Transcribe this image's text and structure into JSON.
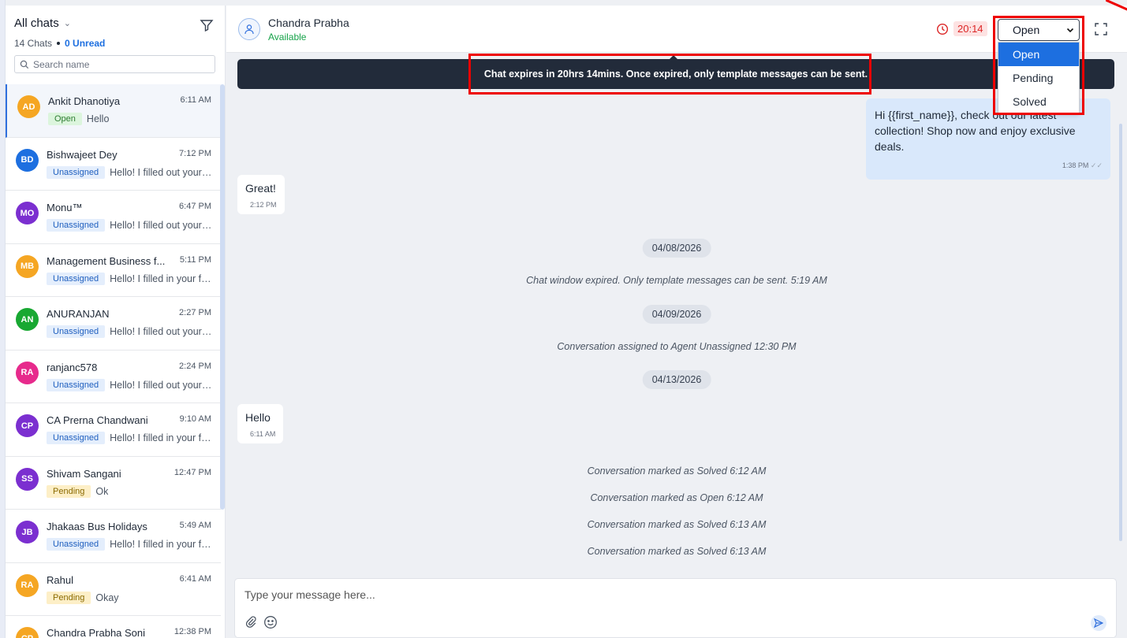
{
  "sidebar": {
    "title": "All chats",
    "chats_count": "14 Chats",
    "unread": "0 Unread",
    "search_placeholder": "Search name",
    "chats": [
      {
        "initials": "AD",
        "name": "Ankit Dhanotiya",
        "time": "6:11 AM",
        "status": "Open",
        "message": "Hello",
        "color": "#f5a623"
      },
      {
        "initials": "BD",
        "name": "Bishwajeet Dey",
        "time": "7:12 PM",
        "status": "Unassigned",
        "message": "Hello! I filled out your form...",
        "color": "#1d6fe0"
      },
      {
        "initials": "MO",
        "name": "Monu™",
        "time": "6:47 PM",
        "status": "Unassigned",
        "message": "Hello! I filled out your form...",
        "color": "#7b2fd0"
      },
      {
        "initials": "MB",
        "name": "Management Business f...",
        "time": "5:11 PM",
        "status": "Unassigned",
        "message": "Hello! I filled in your form...",
        "color": "#f5a623"
      },
      {
        "initials": "AN",
        "name": "ANURANJAN",
        "time": "2:27 PM",
        "status": "Unassigned",
        "message": "Hello! I filled out your form...",
        "color": "#18a832"
      },
      {
        "initials": "RA",
        "name": "ranjanc578",
        "time": "2:24 PM",
        "status": "Unassigned",
        "message": "Hello! I filled out your form...",
        "color": "#e72a8c"
      },
      {
        "initials": "CP",
        "name": "CA Prerna Chandwani",
        "time": "9:10 AM",
        "status": "Unassigned",
        "message": "Hello! I filled in your form...",
        "color": "#7b2fd0"
      },
      {
        "initials": "SS",
        "name": "Shivam Sangani",
        "time": "12:47 PM",
        "status": "Pending",
        "message": "Ok",
        "color": "#7b2fd0"
      },
      {
        "initials": "JB",
        "name": "Jhakaas Bus Holidays",
        "time": "5:49 AM",
        "status": "Unassigned",
        "message": "Hello! I filled in your form...",
        "color": "#7b2fd0"
      },
      {
        "initials": "RA",
        "name": "Rahul",
        "time": "6:41 AM",
        "status": "Pending",
        "message": "Okay",
        "color": "#f5a623"
      },
      {
        "initials": "CP",
        "name": "Chandra Prabha Soni",
        "time": "12:38 PM",
        "status": "",
        "message": "",
        "color": "#f5a623"
      }
    ]
  },
  "header": {
    "contact_name": "Chandra Prabha",
    "contact_status": "Available",
    "timer": "20:14",
    "status_value": "Open",
    "status_options": [
      "Open",
      "Pending",
      "Solved"
    ]
  },
  "banner": {
    "text": "Chat expires in 20hrs 14mins. Once expired, only template messages can be sent."
  },
  "messages": {
    "outgoing_text": "Hi {{first_name}}, check out our latest collection! Shop now and enjoy exclusive deals.",
    "outgoing_time": "1:38 PM",
    "in1_text": "Great!",
    "in1_time": "2:12 PM",
    "date1": "04/08/2026",
    "sys1": "Chat window expired. Only template messages can be sent. 5:19 AM",
    "date2": "04/09/2026",
    "sys2": "Conversation assigned to Agent Unassigned 12:30 PM",
    "date3": "04/13/2026",
    "in2_text": "Hello",
    "in2_time": "6:11 AM",
    "sys3": "Conversation marked as Solved 6:12 AM",
    "sys4": "Conversation marked as Open 6:12 AM",
    "sys5": "Conversation marked as Solved 6:13 AM",
    "sys6": "Conversation marked as Solved 6:13 AM"
  },
  "composer": {
    "placeholder": "Type your message here..."
  },
  "colors": {
    "accent": "#1d6fe0",
    "banner_bg": "#222b3a",
    "highlight": "#ee0000",
    "timer": "#dc2626"
  }
}
